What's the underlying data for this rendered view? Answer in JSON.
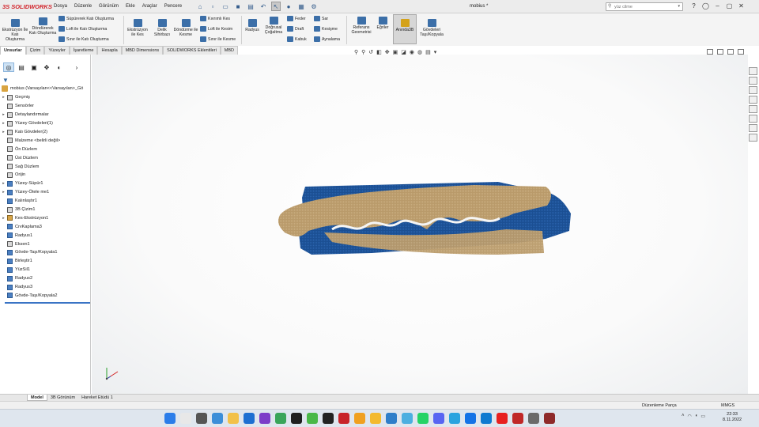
{
  "app": {
    "brand": "SOLIDWORKS",
    "brand_prefix": "3S",
    "document_title": "mobius *"
  },
  "menu": [
    "Dosya",
    "Düzenle",
    "Görünüm",
    "Ekle",
    "Araçlar",
    "Pencere"
  ],
  "search": {
    "placeholder": "yüz cilme"
  },
  "ribbon": {
    "extrude_boss": "Ekstrüzyon İle Katı Oluşturma",
    "revolve_boss": "Döndürerek Katı Oluşturma",
    "sweep_boss": "Süpürerek Katı Oluşturma",
    "loft_boss": "Loft ile Katı Oluşturma",
    "boundary_boss": "Sınır ile Katı Oluşturma",
    "extrude_cut": "Ekstrüzyon ile Kes",
    "hole_wizard": "Delik Sihirbazı",
    "revolve_cut": "Döndürme ile Kesme",
    "swept_cut": "Kıvrımlı Kes",
    "loft_cut": "Loft ile Kesim",
    "boundary_cut": "Sınır ile Kesme",
    "fillet": "Radyus",
    "linear_pattern": "Doğrusal Çoğaltma",
    "rib": "Feder",
    "draft": "Draft",
    "shell": "Kabuk",
    "wrap": "Sar",
    "intersect": "Kesişme",
    "mirror": "Aynalama",
    "ref_geometry": "Referans Geometrisi",
    "curves": "Eğriler",
    "instant3d": "Anında3B",
    "move_copy_bodies": "Gövdeleri Taşı/Kopyala"
  },
  "command_tabs": [
    "Unsurlar",
    "Çizim",
    "Yüzeyler",
    "İşaretleme",
    "Hesapla",
    "MBD Dimensions",
    "SOLIDWORKS Eklentileri",
    "MBD"
  ],
  "tree": {
    "root": "mobius (Varsayılan<<Varsayılan>_Gö",
    "items": [
      {
        "label": "Geçmiş",
        "exp": "▸",
        "icon": "gray"
      },
      {
        "label": "Sensörler",
        "exp": "",
        "icon": "gray"
      },
      {
        "label": "Detaylandırmalar",
        "exp": "▸",
        "icon": "gray"
      },
      {
        "label": "Yüzey Gövdeleri(1)",
        "exp": "▸",
        "icon": "gray"
      },
      {
        "label": "Katı Gövdeler(2)",
        "exp": "▸",
        "icon": "gray"
      },
      {
        "label": "Malzeme <belirli değil>",
        "exp": "",
        "icon": "gray"
      },
      {
        "label": "Ön Düzlem",
        "exp": "",
        "icon": "gray"
      },
      {
        "label": "Üst Düzlem",
        "exp": "",
        "icon": "gray"
      },
      {
        "label": "Sağ Düzlem",
        "exp": "",
        "icon": "gray"
      },
      {
        "label": "Orijin",
        "exp": "",
        "icon": "gray"
      },
      {
        "label": "Yüzey-Süpür1",
        "exp": "▸",
        "icon": "blue"
      },
      {
        "label": "Yüzey-Ötele me1",
        "exp": "▸",
        "icon": "blue"
      },
      {
        "label": "Kalınlaştır1",
        "exp": "",
        "icon": "blue"
      },
      {
        "label": "3B Çizim1",
        "exp": "",
        "icon": "gray"
      },
      {
        "label": "Kes-Ekstrüzyon1",
        "exp": "▸",
        "icon": "gold"
      },
      {
        "label": "CrvKaplama3",
        "exp": "",
        "icon": "blue"
      },
      {
        "label": "Radyus1",
        "exp": "",
        "icon": "blue"
      },
      {
        "label": "Eksen1",
        "exp": "",
        "icon": "gray"
      },
      {
        "label": "Gövde-Taşı/Kopyala1",
        "exp": "",
        "icon": "blue"
      },
      {
        "label": "Birleştir1",
        "exp": "",
        "icon": "blue"
      },
      {
        "label": "YüzSil1",
        "exp": "",
        "icon": "blue"
      },
      {
        "label": "Radyus2",
        "exp": "",
        "icon": "blue"
      },
      {
        "label": "Radyus3",
        "exp": "",
        "icon": "blue"
      },
      {
        "label": "Gövde-Taşı/Kopyala2",
        "exp": "",
        "icon": "blue"
      }
    ]
  },
  "bottom_tabs": [
    "Model",
    "3B Görünüm",
    "Hareket Etüdü 1"
  ],
  "status": {
    "mode": "Düzenleme Parça",
    "units": "MMGS"
  },
  "taskbar": {
    "time": "22:33",
    "date": "8.11.2022"
  },
  "colors": {
    "brand_red": "#d2232a",
    "model_blue": "#1b4f93",
    "model_tan": "#b99a6a",
    "accent": "#3a74c5"
  }
}
